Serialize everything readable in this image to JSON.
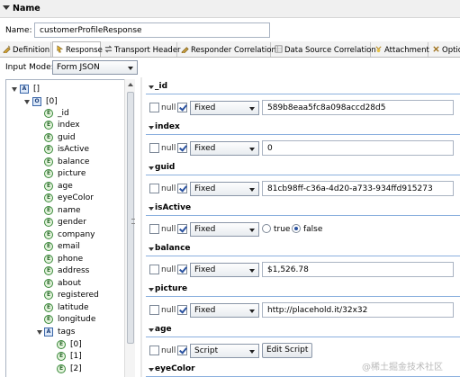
{
  "section_title": "Name",
  "name": {
    "label": "Name:",
    "value": "customerProfileResponse"
  },
  "tabs": [
    {
      "label": "Definition",
      "icon": "definition-icon",
      "active": false
    },
    {
      "label": "Response",
      "icon": "response-icon",
      "active": true
    },
    {
      "label": "Transport Header",
      "icon": "transport-icon",
      "active": false
    },
    {
      "label": "Responder Correlation",
      "icon": "correlation-icon",
      "active": false
    },
    {
      "label": "Data Source Correlation",
      "icon": "datasource-icon",
      "active": false
    },
    {
      "label": "Attachment",
      "icon": "attachment-icon",
      "active": false
    },
    {
      "label": "Optio",
      "icon": "options-icon",
      "active": false
    }
  ],
  "input_mode": {
    "label": "Input Mode:",
    "value": "Form JSON"
  },
  "tree": {
    "root": "[]",
    "child": "[0]",
    "fields": [
      "_id",
      "index",
      "guid",
      "isActive",
      "balance",
      "picture",
      "age",
      "eyeColor",
      "name",
      "gender",
      "company",
      "email",
      "phone",
      "address",
      "about",
      "registered",
      "latitude",
      "longitude"
    ],
    "tags": "tags",
    "tag_items": [
      "[0]",
      "[1]",
      "[2]"
    ]
  },
  "null_label": "null",
  "properties": [
    {
      "name": "_id",
      "mode": "Fixed",
      "kind": "text",
      "value": "589b8eaa5fc8a098accd28d5"
    },
    {
      "name": "index",
      "mode": "Fixed",
      "kind": "text",
      "value": "0"
    },
    {
      "name": "guid",
      "mode": "Fixed",
      "kind": "text",
      "value": "81cb98ff-c36a-4d20-a733-934ffd915273"
    },
    {
      "name": "isActive",
      "mode": "Fixed",
      "kind": "bool",
      "true_label": "true",
      "false_label": "false",
      "selected": "false"
    },
    {
      "name": "balance",
      "mode": "Fixed",
      "kind": "text",
      "value": "$1,526.78"
    },
    {
      "name": "picture",
      "mode": "Fixed",
      "kind": "text",
      "value": "http://placehold.it/32x32"
    },
    {
      "name": "age",
      "mode": "Script",
      "kind": "button",
      "button_label": "Edit Script"
    },
    {
      "name": "eyeColor",
      "mode": "",
      "kind": "header-only"
    }
  ],
  "watermark": "@稀土掘金技术社区",
  "colors": {
    "accent": "#2a52a0",
    "border": "#a9b3c2",
    "header_line": "#8bb0de"
  }
}
